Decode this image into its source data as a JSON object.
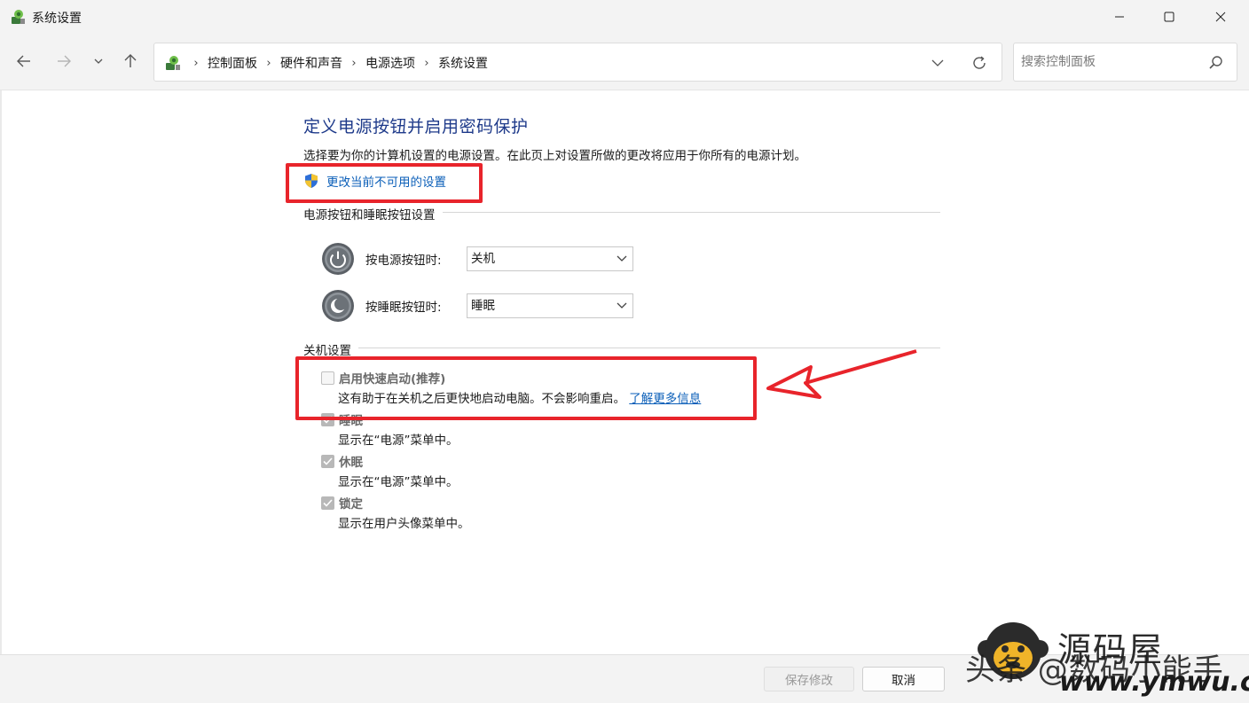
{
  "window": {
    "title": "系统设置"
  },
  "breadcrumbs": [
    "控制面板",
    "硬件和声音",
    "电源选项",
    "系统设置"
  ],
  "search": {
    "placeholder": "搜索控制面板"
  },
  "main": {
    "heading": "定义电源按钮并启用密码保护",
    "description": "选择要为你的计算机设置的电源设置。在此页上对设置所做的更改将应用于你所有的电源计划。",
    "change_link": "更改当前不可用的设置"
  },
  "power_section": {
    "title": "电源按钮和睡眠按钮设置",
    "power_button": {
      "label": "按电源按钮时:",
      "value": "关机"
    },
    "sleep_button": {
      "label": "按睡眠按钮时:",
      "value": "睡眠"
    }
  },
  "shutdown_section": {
    "title": "关机设置",
    "items": [
      {
        "label": "启用快速启动(推荐)",
        "checked": false,
        "desc": "这有助于在关机之后更快地启动电脑。不会影响重启。",
        "link": "了解更多信息"
      },
      {
        "label": "睡眠",
        "checked": true,
        "desc": "显示在“电源”菜单中。"
      },
      {
        "label": "休眠",
        "checked": true,
        "desc": "显示在“电源”菜单中。"
      },
      {
        "label": "锁定",
        "checked": true,
        "desc": "显示在用户头像菜单中。"
      }
    ]
  },
  "footer": {
    "save_label": "保存修改",
    "cancel_label": "取消"
  },
  "watermark": {
    "brand": "源码屋",
    "user": "头条 @数码小能手",
    "url": "www.ymwu.com"
  },
  "colors": {
    "heading": "#1e3a8a",
    "link": "#0a5eb8",
    "highlight": "#e8242b"
  },
  "icons": {
    "window": "control-panel-icon",
    "back": "arrow-left-icon",
    "forward": "arrow-right-icon",
    "recent": "chevron-down-icon",
    "up": "arrow-up-icon",
    "refresh": "refresh-icon",
    "search": "search-icon",
    "shield": "uac-shield-icon",
    "power": "power-icon",
    "sleep": "sleep-moon-icon"
  }
}
